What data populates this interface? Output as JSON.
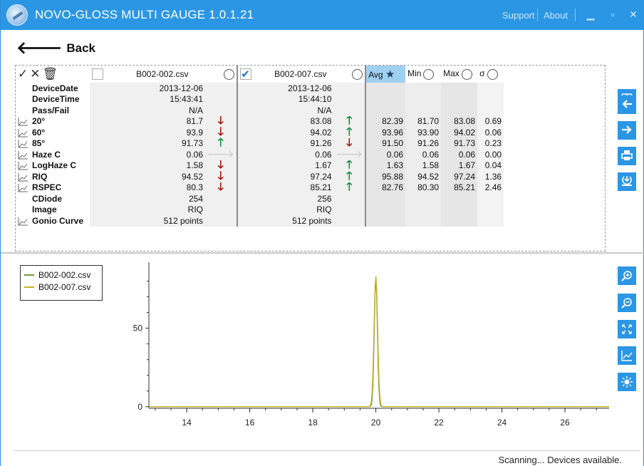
{
  "window": {
    "title": "NOVO-GLOSS MULTI GAUGE 1.0.1.21",
    "support_label": "Support",
    "about_label": "About",
    "minimize_icon": "minimize-icon",
    "maximize_icon": "maximize-icon",
    "close_icon": "close-icon"
  },
  "nav": {
    "back_label": "Back"
  },
  "table": {
    "header": {
      "file1": "B002-002.csv",
      "file1_checked": false,
      "file2": "B002-007.csv",
      "file2_checked": true,
      "avg": "Avg",
      "min": "Min",
      "max": "Max",
      "sigma": "σ",
      "icons": [
        "check-icon",
        "close-icon",
        "trash-icon",
        "star-icon",
        "radio-icon"
      ]
    },
    "rows": [
      {
        "name": "DeviceDate",
        "trend": false,
        "v1": "2013-12-06",
        "a1": "",
        "v2": "2013-12-06",
        "a2": "",
        "avg": "",
        "min": "",
        "max": "",
        "sd": ""
      },
      {
        "name": "DeviceTime",
        "trend": false,
        "v1": "15:43:41",
        "a1": "",
        "v2": "15:44:10",
        "a2": "",
        "avg": "",
        "min": "",
        "max": "",
        "sd": ""
      },
      {
        "name": "Pass/Fail",
        "trend": false,
        "v1": "N/A",
        "a1": "",
        "v2": "N/A",
        "a2": "",
        "avg": "",
        "min": "",
        "max": "",
        "sd": ""
      },
      {
        "name": "20°",
        "trend": true,
        "v1": "81.7",
        "a1": "down",
        "v2": "83.08",
        "a2": "up",
        "avg": "82.39",
        "min": "81.70",
        "max": "83.08",
        "sd": "0.69"
      },
      {
        "name": "60°",
        "trend": true,
        "v1": "93.9",
        "a1": "down",
        "v2": "94.02",
        "a2": "up",
        "avg": "93.96",
        "min": "93.90",
        "max": "94.02",
        "sd": "0.06"
      },
      {
        "name": "85°",
        "trend": true,
        "v1": "91.73",
        "a1": "up",
        "v2": "91.26",
        "a2": "down",
        "avg": "91.50",
        "min": "91.26",
        "max": "91.73",
        "sd": "0.23"
      },
      {
        "name": "Haze C",
        "trend": true,
        "v1": "0.06",
        "a1": "flat",
        "v2": "0.06",
        "a2": "flat",
        "avg": "0.06",
        "min": "0.06",
        "max": "0.06",
        "sd": "0.00"
      },
      {
        "name": "LogHaze C",
        "trend": true,
        "v1": "1.58",
        "a1": "down",
        "v2": "1.67",
        "a2": "up",
        "avg": "1.63",
        "min": "1.58",
        "max": "1.67",
        "sd": "0.04"
      },
      {
        "name": "RIQ",
        "trend": true,
        "v1": "94.52",
        "a1": "down",
        "v2": "97.24",
        "a2": "up",
        "avg": "95.88",
        "min": "94.52",
        "max": "97.24",
        "sd": "1.36"
      },
      {
        "name": "RSPEC",
        "trend": true,
        "v1": "80.3",
        "a1": "down",
        "v2": "85.21",
        "a2": "up",
        "avg": "82.76",
        "min": "80.30",
        "max": "85.21",
        "sd": "2.46"
      },
      {
        "name": "CDiode",
        "trend": false,
        "v1": "254",
        "a1": "",
        "v2": "256",
        "a2": "",
        "avg": "",
        "min": "",
        "max": "",
        "sd": ""
      },
      {
        "name": "Image",
        "trend": false,
        "v1": "RIQ",
        "a1": "",
        "v2": "RIQ",
        "a2": "",
        "avg": "",
        "min": "",
        "max": "",
        "sd": ""
      },
      {
        "name": "Gonio Curve",
        "trend": true,
        "v1": "512 points",
        "a1": "",
        "v2": "512 points",
        "a2": "",
        "avg": "",
        "min": "",
        "max": "",
        "sd": ""
      }
    ]
  },
  "side_buttons_top": [
    "camera-icon",
    "arrow-left-icon",
    "arrow-right-icon",
    "print-icon",
    "export-icon"
  ],
  "side_buttons_bottom": [
    "zoom-in-icon",
    "zoom-out-icon",
    "fit-icon",
    "chart-icon",
    "brightness-icon"
  ],
  "colors": {
    "accent": "#2b96e4",
    "series1": "#6f9a3c",
    "series2": "#c7b12a",
    "up": "#0a8f3c",
    "down": "#a20f0f"
  },
  "chart_data": {
    "type": "line",
    "xlim": [
      12.8,
      27.4
    ],
    "ylim": [
      -1,
      92
    ],
    "xticks": [
      14,
      16,
      18,
      20,
      22,
      24,
      26
    ],
    "yticks": [
      0,
      50
    ],
    "series": [
      {
        "name": "B002-002.csv",
        "peak_x": 20.0,
        "peak_y": 81.7,
        "width": 0.07,
        "baseline": 0.06
      },
      {
        "name": "B002-007.csv",
        "peak_x": 20.0,
        "peak_y": 83.08,
        "width": 0.08,
        "baseline": 0.06
      }
    ]
  },
  "status": {
    "text": "Scanning... Devices available."
  }
}
